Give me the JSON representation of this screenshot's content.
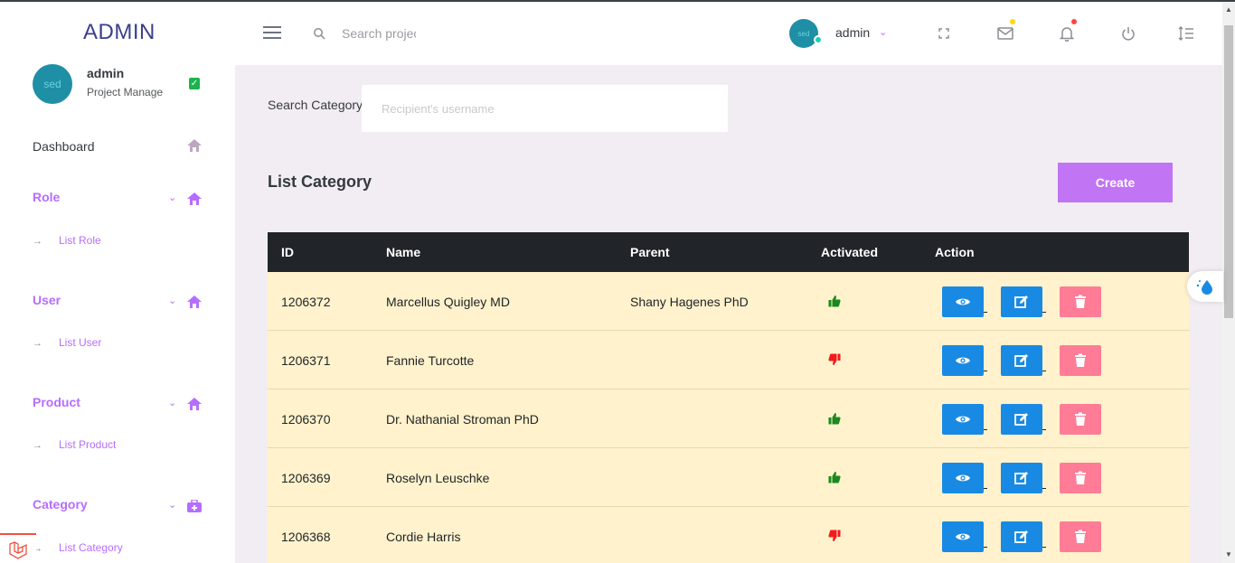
{
  "brand": "ADMIN",
  "profile": {
    "avatar_text": "sed",
    "name": "admin",
    "role": "Project Manage"
  },
  "sidebar": {
    "dashboard": "Dashboard",
    "sections": [
      {
        "label": "Role",
        "sub": "List Role"
      },
      {
        "label": "User",
        "sub": "List User"
      },
      {
        "label": "Product",
        "sub": "List Product"
      },
      {
        "label": "Category",
        "sub": "List Category"
      }
    ]
  },
  "topbar": {
    "search_placeholder": "Search projects",
    "avatar_text": "sed",
    "user": "admin"
  },
  "main": {
    "search_label": "Search Category",
    "search_placeholder": "Recipient's username",
    "title": "List Category",
    "create_label": "Create",
    "headers": [
      "ID",
      "Name",
      "Parent",
      "Activated",
      "Action"
    ],
    "rows": [
      {
        "id": "1206372",
        "name": "Marcellus Quigley MD",
        "parent": "Shany Hagenes PhD",
        "activated": true
      },
      {
        "id": "1206371",
        "name": "Fannie Turcotte",
        "parent": "",
        "activated": false
      },
      {
        "id": "1206370",
        "name": "Dr. Nathanial Stroman PhD",
        "parent": "",
        "activated": true
      },
      {
        "id": "1206369",
        "name": "Roselyn Leuschke",
        "parent": "",
        "activated": true
      },
      {
        "id": "1206368",
        "name": "Cordie Harris",
        "parent": "",
        "activated": false
      }
    ]
  },
  "colors": {
    "accent": "#b66dff",
    "info": "#198ae3",
    "danger": "#fe7c96",
    "row_bg": "#fff2cc",
    "header_bg": "#212529"
  }
}
